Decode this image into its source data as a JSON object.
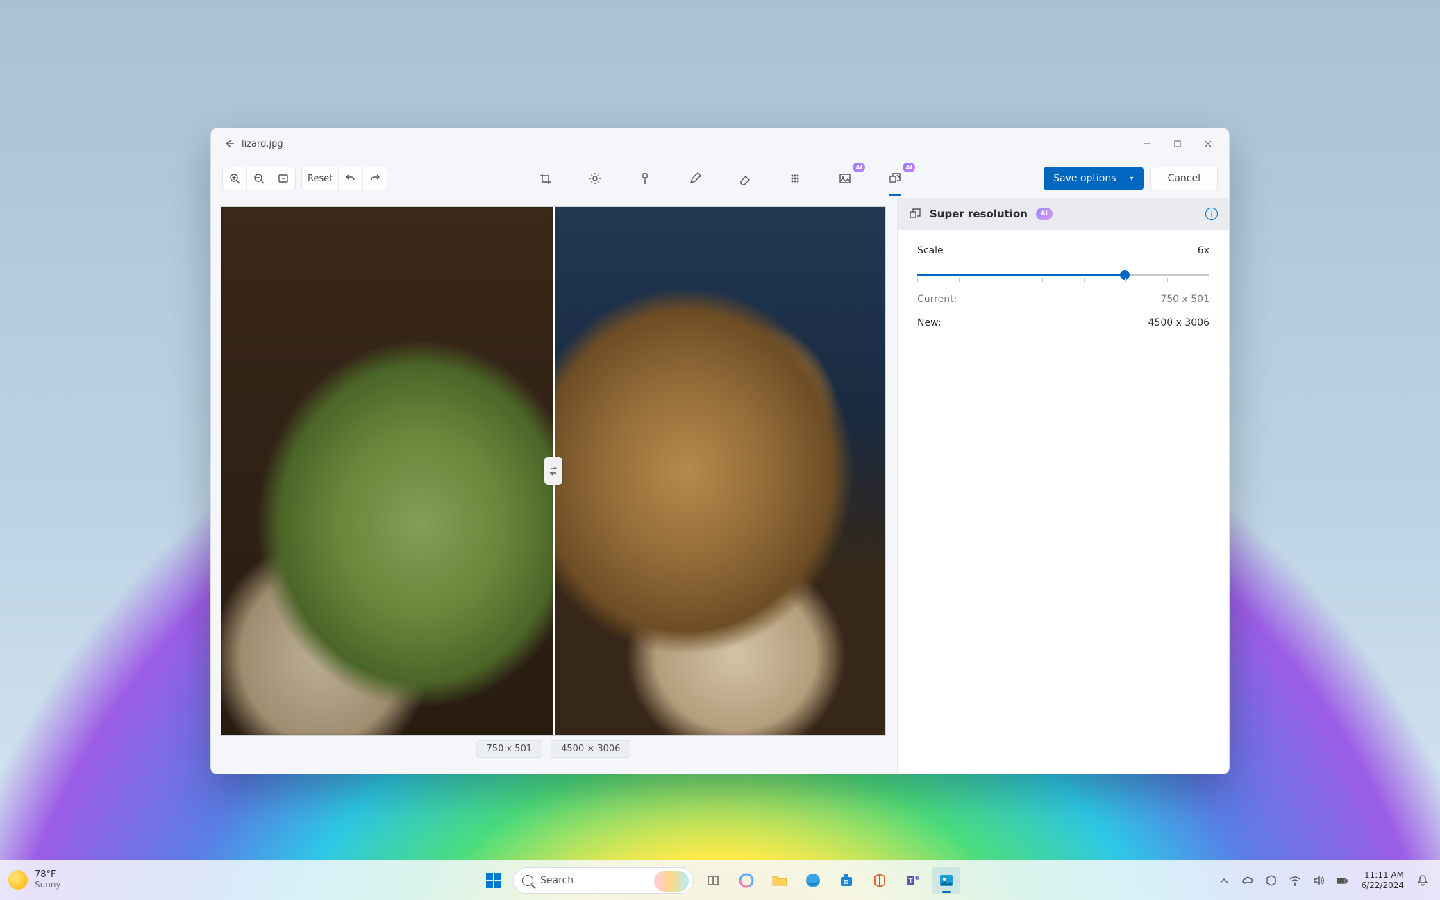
{
  "window": {
    "filename": "lizard.jpg"
  },
  "toolbar": {
    "reset_label": "Reset",
    "save_label": "Save options",
    "cancel_label": "Cancel",
    "ai_badge": "AI"
  },
  "canvas": {
    "left_dim": "750 x 501",
    "right_dim": "4500 × 3006"
  },
  "panel": {
    "title": "Super resolution",
    "ai_badge": "AI",
    "scale_label": "Scale",
    "scale_value": "6x",
    "current_label": "Current:",
    "current_value": "750 x 501",
    "new_label": "New:",
    "new_value": "4500 x 3006"
  },
  "taskbar": {
    "weather_temp": "78°F",
    "weather_cond": "Sunny",
    "search_label": "Search",
    "time": "11:11 AM",
    "date": "6/22/2024"
  }
}
